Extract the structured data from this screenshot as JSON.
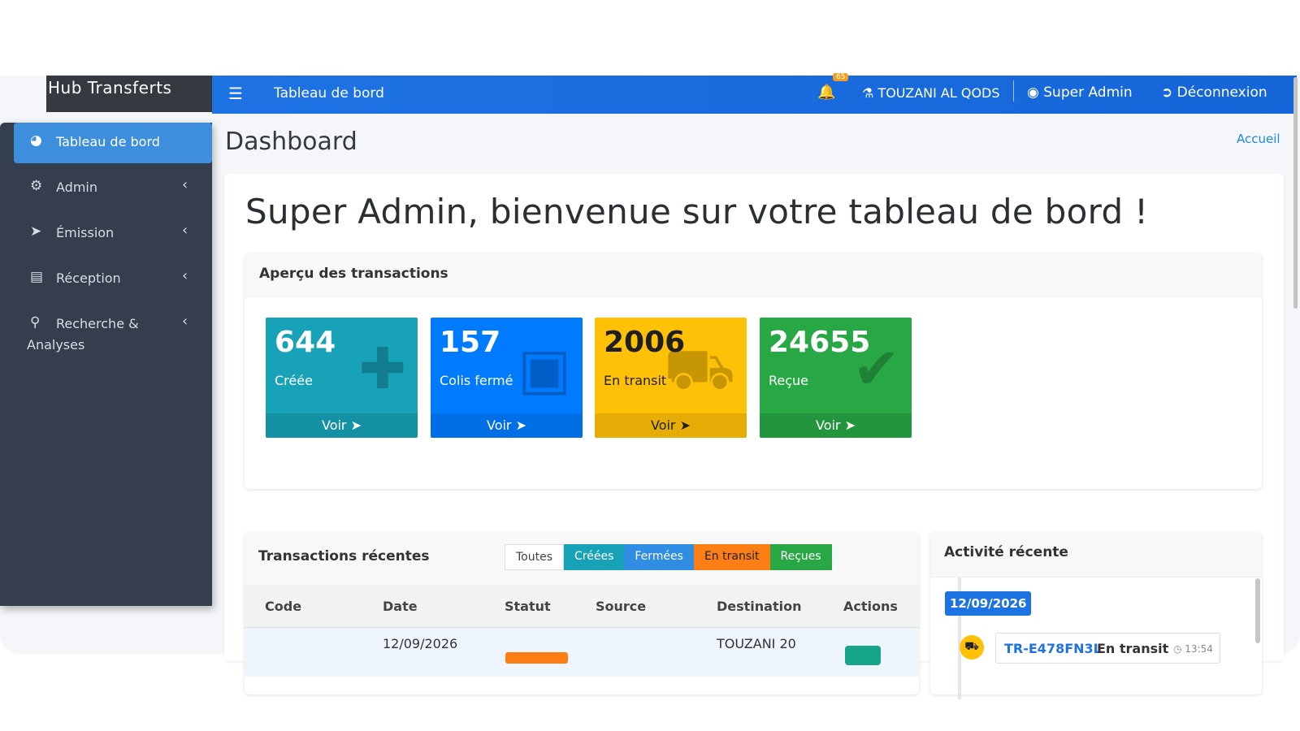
{
  "brand": "Hub Transferts",
  "topbar": {
    "title": "Tableau de bord",
    "notifications": "65",
    "agency": "TOUZANI AL QODS",
    "user": "Super Admin",
    "logout": "Déconnexion"
  },
  "sidebar": {
    "items": [
      {
        "label": "Tableau de bord",
        "icon": "tachometer-icon"
      },
      {
        "label": "Admin",
        "icon": "cogs-icon"
      },
      {
        "label": "Émission",
        "icon": "paper-plane-icon"
      },
      {
        "label": "Réception",
        "icon": "inbox-icon"
      },
      {
        "label": "Recherche &",
        "label2": "Analyses",
        "icon": "search-plus-icon"
      }
    ]
  },
  "page": {
    "title": "Dashboard",
    "breadcrumb": "Accueil",
    "welcome": "Super Admin, bienvenue sur votre tableau de bord !"
  },
  "overview": {
    "title": "Aperçu des transactions",
    "stats": [
      {
        "value": "644",
        "label": "Créée",
        "link": "Voir",
        "color": "#17a2b8",
        "icon": "plus-icon"
      },
      {
        "value": "157",
        "label": "Colis fermé",
        "link": "Voir",
        "color": "#007bff",
        "icon": "box-icon"
      },
      {
        "value": "2006",
        "label": "En transit",
        "link": "Voir",
        "color": "#ffc107",
        "icon": "truck-icon"
      },
      {
        "value": "24655",
        "label": "Reçue",
        "link": "Voir",
        "color": "#28a745",
        "icon": "check-icon"
      }
    ]
  },
  "recent": {
    "title": "Transactions récentes",
    "filters": [
      {
        "label": "Toutes",
        "color": "#ffffff"
      },
      {
        "label": "Créées",
        "color": "#17a2b8"
      },
      {
        "label": "Fermées",
        "color": "#2f8de4"
      },
      {
        "label": "En transit",
        "color": "#fd7e14"
      },
      {
        "label": "Reçues",
        "color": "#28a745"
      }
    ],
    "columns": [
      "Code",
      "Date",
      "Statut",
      "Source",
      "Destination",
      "Actions"
    ],
    "rows": [
      {
        "date": "12/09/2026",
        "destination": "TOUZANI 20"
      }
    ]
  },
  "activity": {
    "title": "Activité récente",
    "date": "12/09/2026",
    "item": {
      "code": "TR-E478FN3L",
      "status": "En transit",
      "time": "13:54"
    }
  }
}
